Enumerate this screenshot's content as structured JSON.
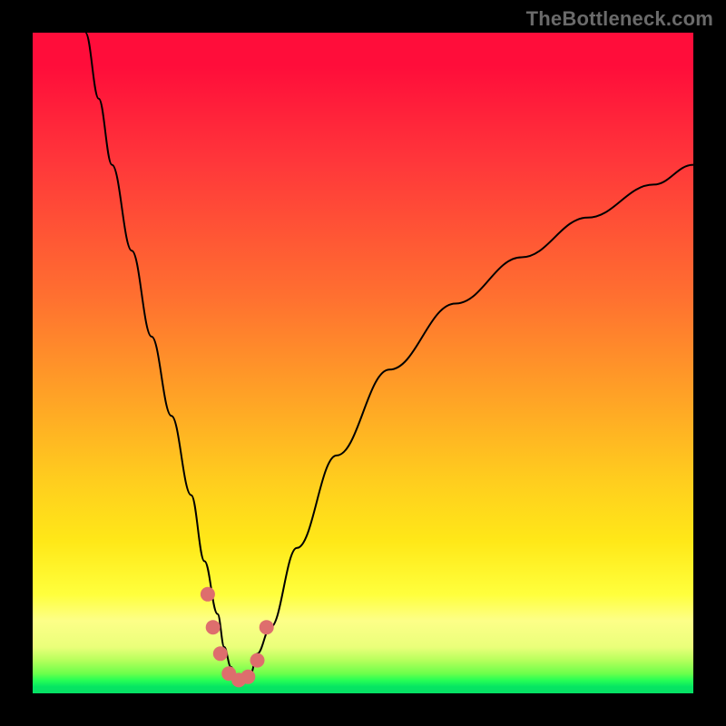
{
  "attribution": "TheBottleneck.com",
  "colors": {
    "frame": "#000000",
    "gradient_top": "#ff0d3a",
    "gradient_mid": "#ffe818",
    "gradient_bottom": "#06e065",
    "curve": "#000000",
    "dots": "#de6e6d"
  },
  "chart_data": {
    "type": "line",
    "title": "",
    "xlabel": "",
    "ylabel": "",
    "xlim": [
      0,
      100
    ],
    "ylim": [
      0,
      100
    ],
    "note": "No numeric axis ticks or data labels are visible in the image; the x/y values below are estimated from pixel positions on a 0–100 grid where y=0 is the bottom green band and y=100 is the top red band.",
    "series": [
      {
        "name": "bottleneck-curve",
        "x": [
          8,
          10,
          12,
          15,
          18,
          21,
          24,
          26,
          28,
          29,
          30,
          31,
          32,
          33,
          34,
          36,
          40,
          46,
          54,
          64,
          74,
          84,
          94,
          100
        ],
        "y": [
          100,
          90,
          80,
          67,
          54,
          42,
          30,
          20,
          12,
          7,
          4,
          2,
          2,
          3,
          6,
          10,
          22,
          36,
          49,
          59,
          66,
          72,
          77,
          80
        ]
      }
    ],
    "markers": [
      {
        "x": 26.5,
        "y": 15
      },
      {
        "x": 27.3,
        "y": 10
      },
      {
        "x": 28.4,
        "y": 6
      },
      {
        "x": 29.7,
        "y": 3
      },
      {
        "x": 31.2,
        "y": 2
      },
      {
        "x": 32.6,
        "y": 2.5
      },
      {
        "x": 34.0,
        "y": 5
      },
      {
        "x": 35.4,
        "y": 10
      }
    ]
  }
}
